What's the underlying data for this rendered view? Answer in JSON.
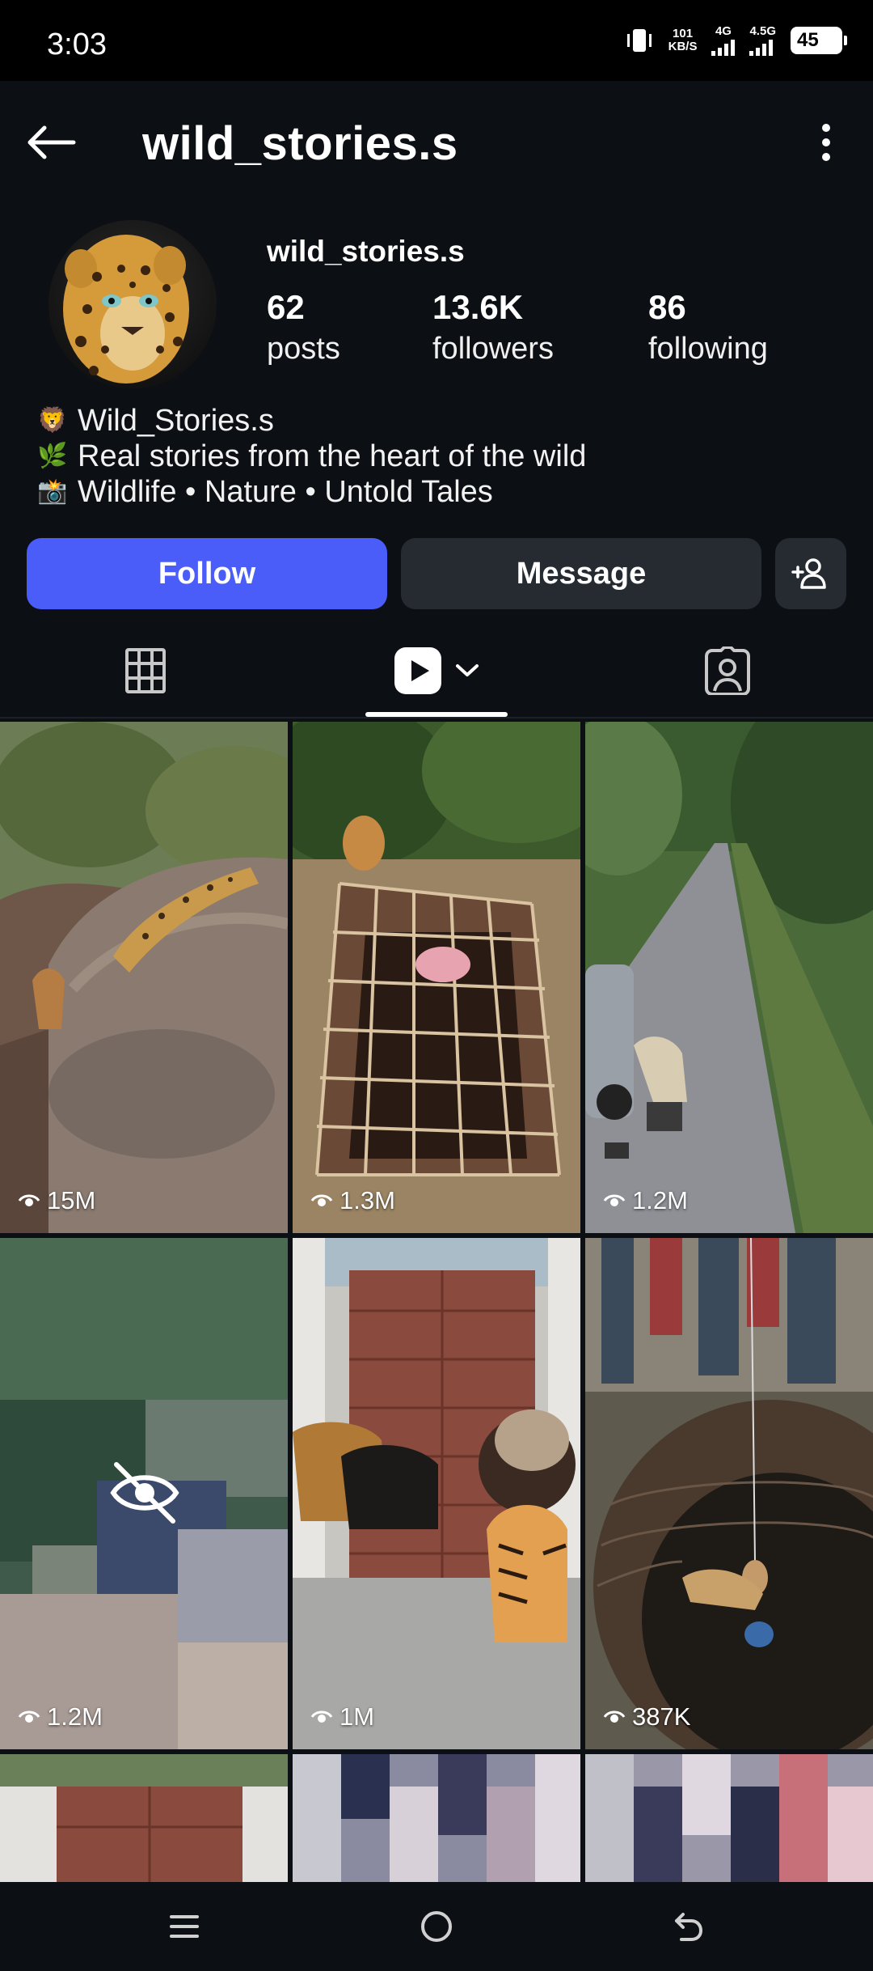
{
  "status_bar": {
    "time": "3:03",
    "speed_value": "101",
    "speed_unit": "KB/S",
    "net1": "4G",
    "net2": "4.5G",
    "battery": "45"
  },
  "header": {
    "title": "wild_stories.s"
  },
  "profile": {
    "username": "wild_stories.s",
    "stats": {
      "posts": {
        "value": "62",
        "label": "posts"
      },
      "followers": {
        "value": "13.6K",
        "label": "followers"
      },
      "following": {
        "value": "86",
        "label": "following"
      }
    },
    "bio": [
      {
        "icon": "lion-icon",
        "emoji": "🦁",
        "text": "Wild_Stories.s"
      },
      {
        "icon": "herb-icon",
        "emoji": "🌿",
        "text": "Real stories from the heart of the wild"
      },
      {
        "icon": "camera-icon",
        "emoji": "📸",
        "text": "Wildlife • Nature • Untold Tales"
      }
    ]
  },
  "actions": {
    "follow_label": "Follow",
    "message_label": "Message"
  },
  "grid": {
    "items": [
      {
        "views": "15M"
      },
      {
        "views": "1.3M"
      },
      {
        "views": "1.2M"
      },
      {
        "views": "1.2M"
      },
      {
        "views": "1M"
      },
      {
        "views": "387K"
      }
    ]
  },
  "colors": {
    "background": "#0c0f14",
    "follow_button": "#4a5df9",
    "secondary_button": "#262a31"
  }
}
